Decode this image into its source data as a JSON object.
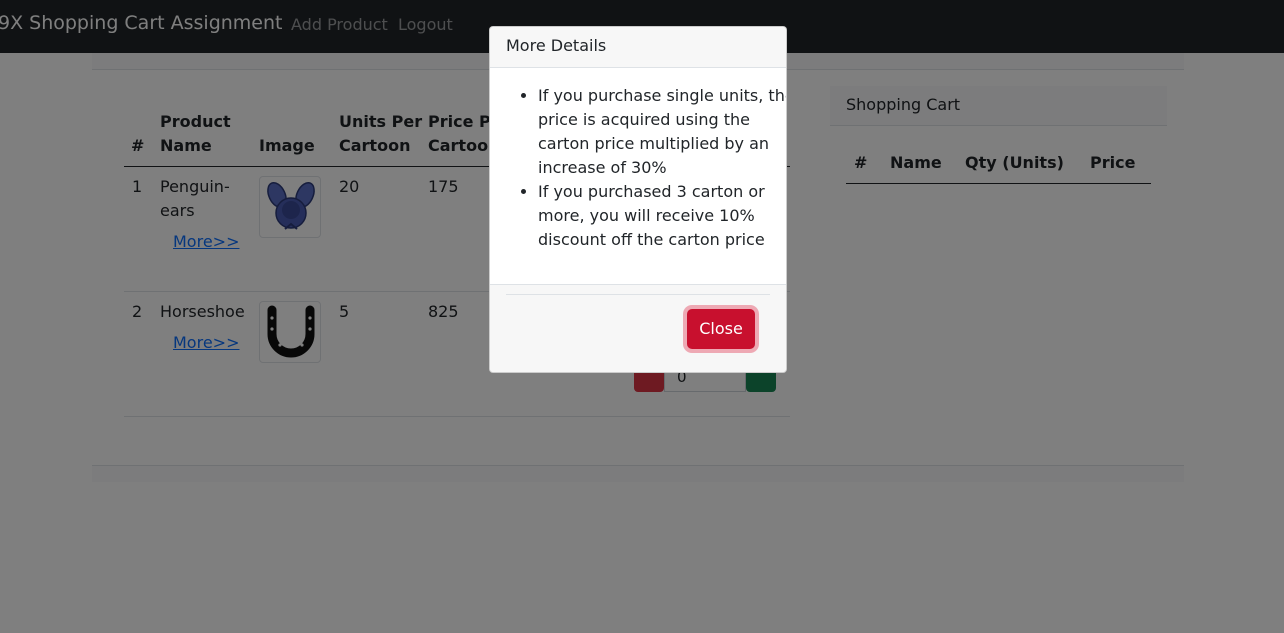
{
  "navbar": {
    "brand": "9X Shopping Cart Assignment",
    "links": [
      "Add Product",
      "Logout"
    ]
  },
  "products_table": {
    "headers": {
      "index": "#",
      "product_name": [
        "Product",
        "Name"
      ],
      "image": "Image",
      "units_per_cartoon": [
        "Units Per",
        "Cartoon"
      ],
      "price_per_cartoon": [
        "Price Per",
        "Cartoon"
      ]
    },
    "rows": [
      {
        "index": "1",
        "name": [
          "Penguin-",
          "ears"
        ],
        "more": "More>>",
        "image_icon": "bunny-ears-icon",
        "units": "20",
        "price": "175"
      },
      {
        "index": "2",
        "name": [
          "Horseshoe"
        ],
        "more": "More>>",
        "image_icon": "horseshoe-icon",
        "units": "5",
        "price": "825"
      }
    ],
    "quantity_value": "0"
  },
  "cart": {
    "title": "Shopping Cart",
    "headers": {
      "index": "#",
      "name": "Name",
      "qty": "Qty (Units)",
      "price": "Price"
    }
  },
  "modal": {
    "title": "More Details",
    "items": [
      "If you purchase single units, the price is acquired using the carton price multiplied by an increase of 30%",
      "If you purchased 3 carton or more, you will receive 10% discount off the carton price"
    ],
    "close_label": "Close"
  },
  "colors": {
    "navbar": "#212529",
    "danger": "#c8102e",
    "success": "#198754",
    "link": "#0d6efd"
  }
}
